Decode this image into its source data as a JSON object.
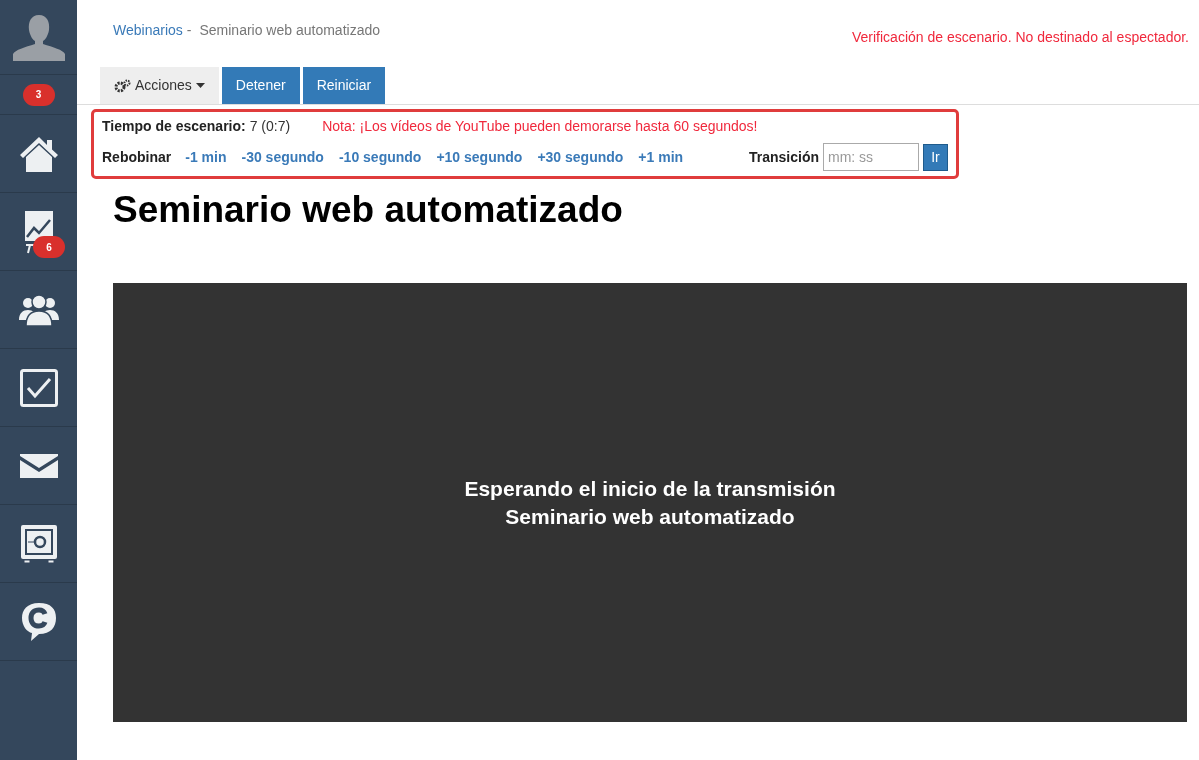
{
  "sidebar": {
    "items": [
      {
        "kind": "avatar"
      },
      {
        "kind": "badge-row",
        "badge": "3"
      },
      {
        "kind": "home"
      },
      {
        "kind": "chart",
        "badge": "6"
      },
      {
        "kind": "users"
      },
      {
        "kind": "check"
      },
      {
        "kind": "mail"
      },
      {
        "kind": "safe"
      },
      {
        "kind": "chat"
      }
    ]
  },
  "breadcrumb": {
    "link": "Webinarios",
    "separator": "-",
    "current": "Seminario web automatizado"
  },
  "notice": "Verificación de escenario. No destinado al espectador.",
  "toolbar": {
    "actions": "Acciones",
    "buttons": [
      "Detener",
      "Reiniciar"
    ]
  },
  "control_panel": {
    "time_label": "Tiempo de escenario:",
    "time_value": "7 (0:7)",
    "note": "Nota: ¡Los vídeos de YouTube pueden demorarse hasta 60 segundos!",
    "rewind_label": "Rebobinar",
    "steps": [
      "-1 min",
      "-30 segundo",
      "-10 segundo",
      "+10 segundo",
      "+30 segundo",
      "+1 min"
    ],
    "transition_label": "Transición",
    "transition_placeholder": "mm: ss",
    "go": "Ir"
  },
  "title": "Seminario web automatizado",
  "player": {
    "lines": [
      "Esperando el inicio de la transmisión",
      "Seminario web automatizado"
    ]
  }
}
